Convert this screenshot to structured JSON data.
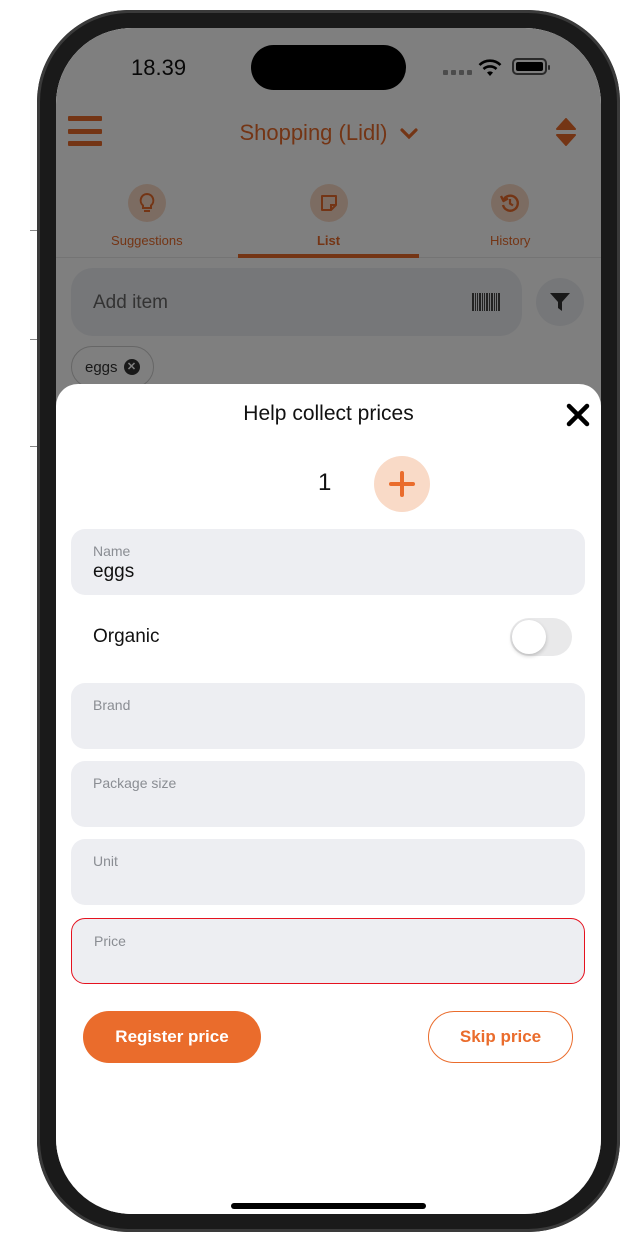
{
  "status_bar": {
    "time": "18.39"
  },
  "header": {
    "title": "Shopping (Lidl)"
  },
  "tabs": [
    {
      "label": "Suggestions",
      "icon": "lightbulb-icon",
      "active": false
    },
    {
      "label": "List",
      "icon": "note-icon",
      "active": true
    },
    {
      "label": "History",
      "icon": "history-icon",
      "active": false
    }
  ],
  "add_item": {
    "placeholder": "Add item"
  },
  "chips": [
    {
      "label": "eggs"
    }
  ],
  "sheet": {
    "title": "Help collect prices",
    "quantity": "1",
    "fields": {
      "name": {
        "label": "Name",
        "value": "eggs"
      },
      "brand": {
        "label": "Brand",
        "value": ""
      },
      "package_size": {
        "label": "Package size",
        "value": ""
      },
      "unit": {
        "label": "Unit",
        "value": ""
      },
      "price": {
        "label": "Price",
        "value": ""
      }
    },
    "organic": {
      "label": "Organic",
      "on": false
    },
    "register_label": "Register price",
    "skip_label": "Skip price"
  },
  "colors": {
    "accent": "#ea6c2c",
    "accent_light": "#f9dac7",
    "error": "#e5121f",
    "field_bg": "#edeef2"
  }
}
